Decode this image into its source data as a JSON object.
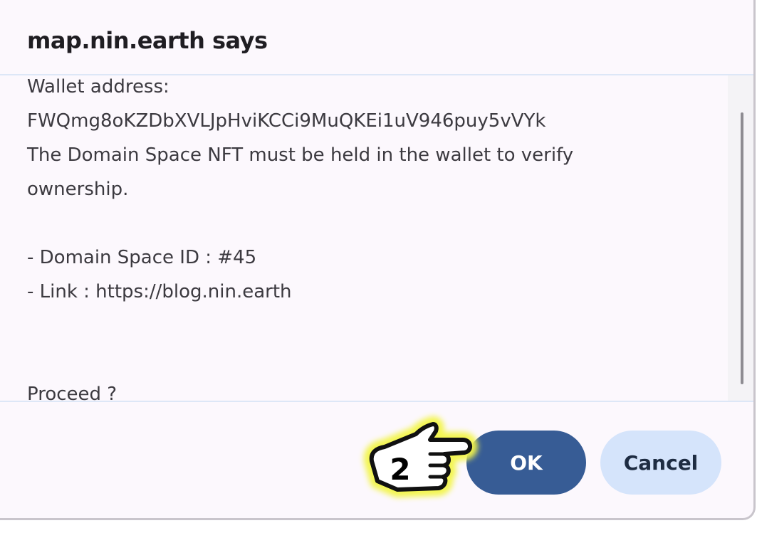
{
  "dialog": {
    "title": "map.nin.earth says",
    "message": "Wallet address:\nFWQmg8oKZDbXVLJpHviKCCi9MuQKEi1uV946puy5vVYk\nThe Domain Space NFT must be held in the wallet to verify\nownership.\n\n- Domain Space ID : #45\n- Link : https://blog.nin.earth\n\n\nProceed ?",
    "ok_label": "OK",
    "cancel_label": "Cancel"
  },
  "annotation": {
    "step_number": "2",
    "icon": "pointing-hand-icon",
    "highlight_color": "#f3f54a"
  },
  "colors": {
    "dialog_background": "#fcf8fd",
    "ok_button": "#375c95",
    "cancel_button": "#d5e4fb",
    "divider": "#dde7f7"
  }
}
